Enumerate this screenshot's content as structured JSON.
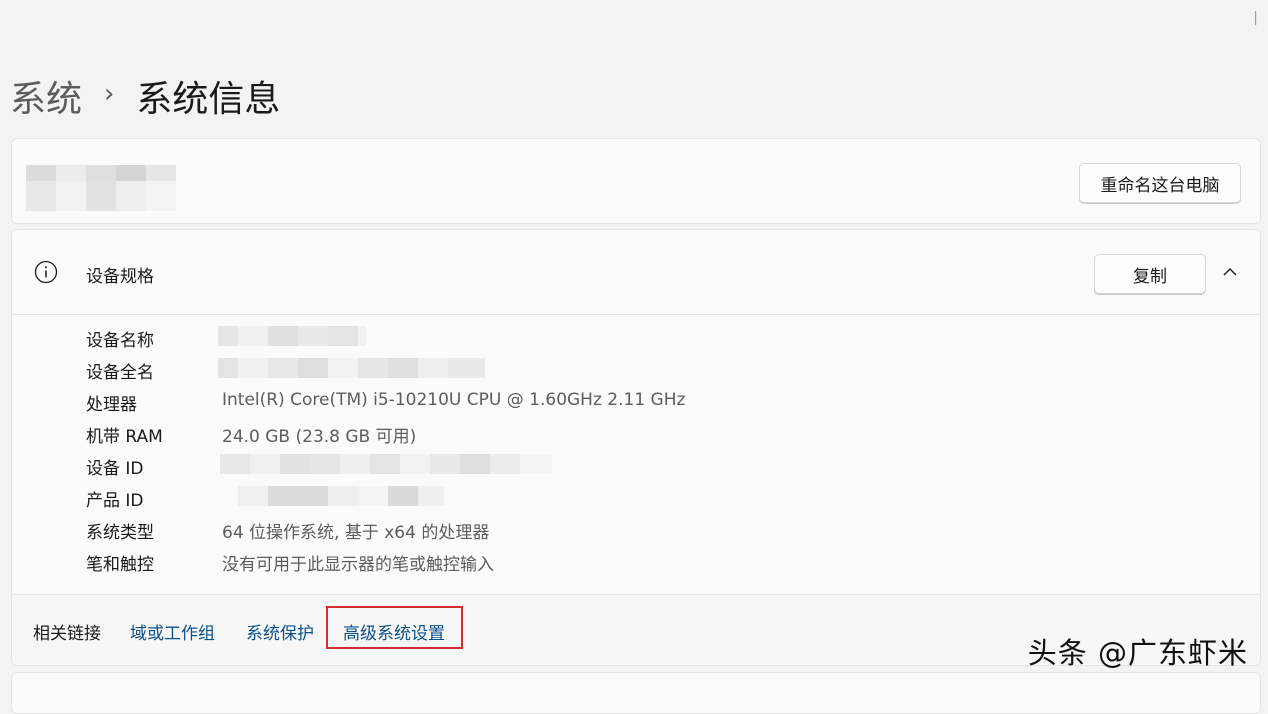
{
  "breadcrumb": {
    "parent": "系统",
    "separator": "›",
    "current": "系统信息"
  },
  "pc_card": {
    "rename_button": "重命名这台电脑"
  },
  "device_specs": {
    "title": "设备规格",
    "copy_button": "复制",
    "rows": [
      {
        "label": "设备名称",
        "value": ""
      },
      {
        "label": "设备全名",
        "value": ""
      },
      {
        "label": "处理器",
        "value": "Intel(R) Core(TM) i5-10210U CPU @ 1.60GHz   2.11 GHz"
      },
      {
        "label": "机带 RAM",
        "value": "24.0 GB (23.8 GB 可用)"
      },
      {
        "label": "设备 ID",
        "value": ""
      },
      {
        "label": "产品 ID",
        "value": ""
      },
      {
        "label": "系统类型",
        "value": "64 位操作系统, 基于 x64 的处理器"
      },
      {
        "label": "笔和触控",
        "value": "没有可用于此显示器的笔或触控输入"
      }
    ]
  },
  "related_links": {
    "label": "相关链接",
    "links": [
      "域或工作组",
      "系统保护",
      "高级系统设置"
    ]
  },
  "watermark": "头条 @广东虾米",
  "colors": {
    "highlight": "#d32f2f",
    "link": "#0a4f8c"
  }
}
